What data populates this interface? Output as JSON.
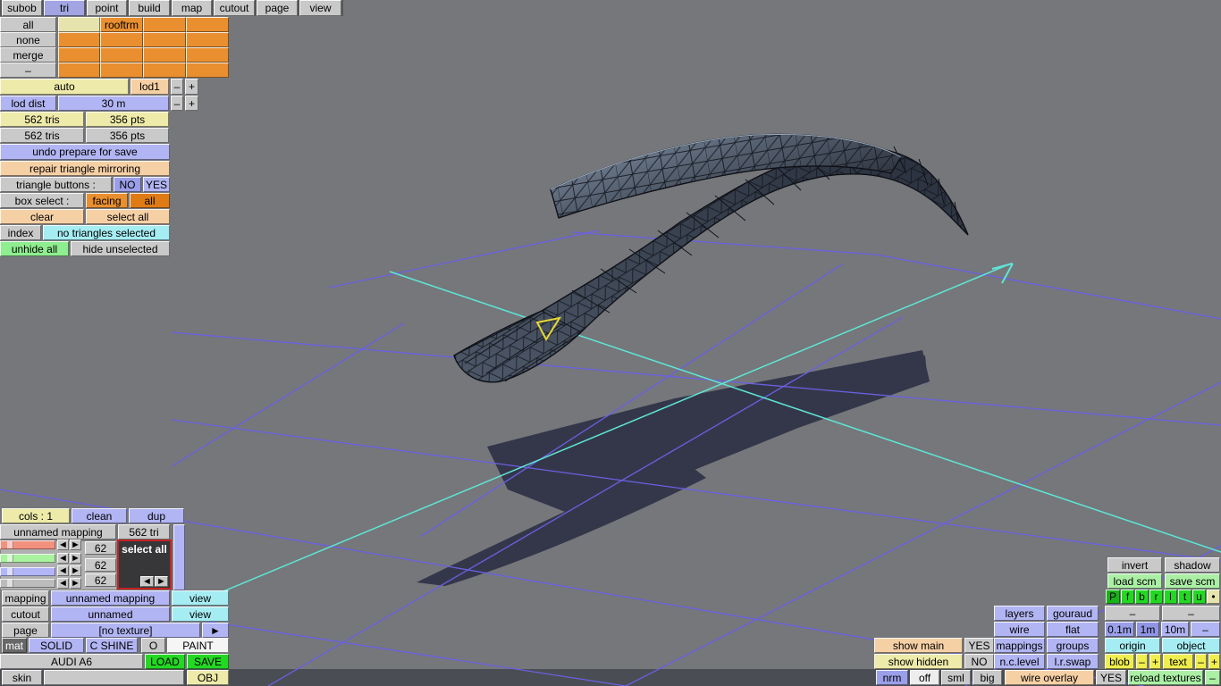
{
  "menu": {
    "items": [
      "subob",
      "tri",
      "point",
      "build",
      "map",
      "cutout",
      "page",
      "view"
    ]
  },
  "subobj": {
    "filters": [
      "all",
      "none",
      "merge",
      "–"
    ],
    "active_name": "rooftrm"
  },
  "lod": {
    "auto": "auto",
    "level": "lod1",
    "minus": "–",
    "plus": "+",
    "dist_label": "lod dist",
    "dist_value": "30 m",
    "tris": "562 tris",
    "pts": "356 pts",
    "tris2": "562 tris",
    "pts2": "356 pts"
  },
  "tools": {
    "undo": "undo prepare for save",
    "repair": "repair triangle mirroring",
    "tri_btn_label": "triangle buttons :",
    "no": "NO",
    "yes": "YES",
    "box_label": "box select :",
    "facing": "facing",
    "all": "all",
    "clear": "clear",
    "select_all": "select all",
    "index": "index",
    "selection": "no triangles selected",
    "unhide": "unhide all",
    "hide": "hide unselected"
  },
  "mapping": {
    "cols": "cols : 1",
    "clean": "clean",
    "dup": "dup",
    "name": "unnamed mapping",
    "count": "562 tri",
    "values": [
      "62",
      "62",
      "62"
    ],
    "select_all": "select all",
    "al": "◄",
    "ar": "►",
    "mapping_label": "mapping",
    "mapping_name": "unnamed mapping",
    "view": "view",
    "cutout_label": "cutout",
    "cutout_name": "unnamed",
    "view2": "view",
    "page_label": "page",
    "page_value": "[no texture]",
    "arrow": "►",
    "mat": "mat",
    "solid": "SOLID",
    "cshine": "C SHINE",
    "o": "O",
    "paint": "PAINT",
    "car": "AUDI A6",
    "load": "LOAD",
    "save": "SAVE",
    "skin": "skin",
    "obj": "OBJ"
  },
  "right": {
    "invert": "invert",
    "shadow": "shadow",
    "load_scm": "load scm",
    "save_scm": "save scm",
    "proj": [
      "P",
      "f",
      "b",
      "r",
      "l",
      "t",
      "u"
    ],
    "dot": "•",
    "layers": "layers",
    "gouraud": "gouraud",
    "d1": "–",
    "d2": "–",
    "wire": "wire",
    "flat": "flat",
    "m01": "0.1m",
    "m1": "1m",
    "m10": "10m",
    "d3": "–",
    "mappings": "mappings",
    "groups": "groups",
    "origin": "origin",
    "object": "object",
    "nclevel": "n.c.level",
    "lrswap": "l.r.swap",
    "blob": "blob",
    "bminus": "–",
    "bplus": "+",
    "text": "text",
    "tminus": "–",
    "tplus": "+",
    "overlay": "wire overlay",
    "overlay_yes": "YES",
    "reload": "reload textures",
    "d4": "–",
    "show_main": "show main",
    "main_yes": "YES",
    "show_hidden": "show hidden",
    "hidden_no": "NO",
    "nrm": "nrm",
    "off": "off",
    "sml": "sml",
    "big": "big"
  },
  "colors": {
    "viewport_bg": "#75777b",
    "grid_line": "#6a60e2",
    "axis": "#5fe5d5",
    "selection": "#e8d832",
    "shadow": "#34374a",
    "mesh_dark": "#2e3542",
    "mesh_light": "#8494a8",
    "panel_orange": "#e98f2f",
    "panel_periwinkle": "#b2b5f3",
    "panel_peach": "#f6d0a5",
    "panel_yellow": "#eeeaa9",
    "panel_green_bright": "#23d823",
    "panel_green_light": "#abefa5",
    "panel_cyan": "#a6edf3"
  }
}
